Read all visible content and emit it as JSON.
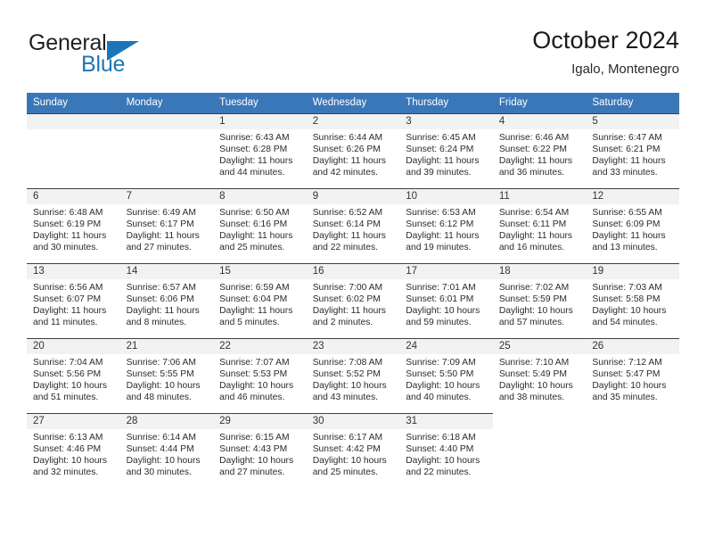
{
  "logo": {
    "word_one": "General",
    "word_two": "Blue",
    "triangle_icon": "triangle-icon",
    "brand_color": "#1b75bb"
  },
  "header": {
    "title": "October 2024",
    "subtitle": "Igalo, Montenegro"
  },
  "theme": {
    "header_bg": "#3a77b8",
    "header_text": "#ffffff",
    "day_band_bg": "#f2f2f2",
    "cell_border": "#3f3f3f",
    "text": "#2b2b2b"
  },
  "weekday_headers": [
    "Sunday",
    "Monday",
    "Tuesday",
    "Wednesday",
    "Thursday",
    "Friday",
    "Saturday"
  ],
  "weeks": [
    [
      {
        "empty": true
      },
      {
        "empty": true
      },
      {
        "day": "1",
        "sunrise": "Sunrise: 6:43 AM",
        "sunset": "Sunset: 6:28 PM",
        "daylight": "Daylight: 11 hours and 44 minutes."
      },
      {
        "day": "2",
        "sunrise": "Sunrise: 6:44 AM",
        "sunset": "Sunset: 6:26 PM",
        "daylight": "Daylight: 11 hours and 42 minutes."
      },
      {
        "day": "3",
        "sunrise": "Sunrise: 6:45 AM",
        "sunset": "Sunset: 6:24 PM",
        "daylight": "Daylight: 11 hours and 39 minutes."
      },
      {
        "day": "4",
        "sunrise": "Sunrise: 6:46 AM",
        "sunset": "Sunset: 6:22 PM",
        "daylight": "Daylight: 11 hours and 36 minutes."
      },
      {
        "day": "5",
        "sunrise": "Sunrise: 6:47 AM",
        "sunset": "Sunset: 6:21 PM",
        "daylight": "Daylight: 11 hours and 33 minutes."
      }
    ],
    [
      {
        "day": "6",
        "sunrise": "Sunrise: 6:48 AM",
        "sunset": "Sunset: 6:19 PM",
        "daylight": "Daylight: 11 hours and 30 minutes."
      },
      {
        "day": "7",
        "sunrise": "Sunrise: 6:49 AM",
        "sunset": "Sunset: 6:17 PM",
        "daylight": "Daylight: 11 hours and 27 minutes."
      },
      {
        "day": "8",
        "sunrise": "Sunrise: 6:50 AM",
        "sunset": "Sunset: 6:16 PM",
        "daylight": "Daylight: 11 hours and 25 minutes."
      },
      {
        "day": "9",
        "sunrise": "Sunrise: 6:52 AM",
        "sunset": "Sunset: 6:14 PM",
        "daylight": "Daylight: 11 hours and 22 minutes."
      },
      {
        "day": "10",
        "sunrise": "Sunrise: 6:53 AM",
        "sunset": "Sunset: 6:12 PM",
        "daylight": "Daylight: 11 hours and 19 minutes."
      },
      {
        "day": "11",
        "sunrise": "Sunrise: 6:54 AM",
        "sunset": "Sunset: 6:11 PM",
        "daylight": "Daylight: 11 hours and 16 minutes."
      },
      {
        "day": "12",
        "sunrise": "Sunrise: 6:55 AM",
        "sunset": "Sunset: 6:09 PM",
        "daylight": "Daylight: 11 hours and 13 minutes."
      }
    ],
    [
      {
        "day": "13",
        "sunrise": "Sunrise: 6:56 AM",
        "sunset": "Sunset: 6:07 PM",
        "daylight": "Daylight: 11 hours and 11 minutes."
      },
      {
        "day": "14",
        "sunrise": "Sunrise: 6:57 AM",
        "sunset": "Sunset: 6:06 PM",
        "daylight": "Daylight: 11 hours and 8 minutes."
      },
      {
        "day": "15",
        "sunrise": "Sunrise: 6:59 AM",
        "sunset": "Sunset: 6:04 PM",
        "daylight": "Daylight: 11 hours and 5 minutes."
      },
      {
        "day": "16",
        "sunrise": "Sunrise: 7:00 AM",
        "sunset": "Sunset: 6:02 PM",
        "daylight": "Daylight: 11 hours and 2 minutes."
      },
      {
        "day": "17",
        "sunrise": "Sunrise: 7:01 AM",
        "sunset": "Sunset: 6:01 PM",
        "daylight": "Daylight: 10 hours and 59 minutes."
      },
      {
        "day": "18",
        "sunrise": "Sunrise: 7:02 AM",
        "sunset": "Sunset: 5:59 PM",
        "daylight": "Daylight: 10 hours and 57 minutes."
      },
      {
        "day": "19",
        "sunrise": "Sunrise: 7:03 AM",
        "sunset": "Sunset: 5:58 PM",
        "daylight": "Daylight: 10 hours and 54 minutes."
      }
    ],
    [
      {
        "day": "20",
        "sunrise": "Sunrise: 7:04 AM",
        "sunset": "Sunset: 5:56 PM",
        "daylight": "Daylight: 10 hours and 51 minutes."
      },
      {
        "day": "21",
        "sunrise": "Sunrise: 7:06 AM",
        "sunset": "Sunset: 5:55 PM",
        "daylight": "Daylight: 10 hours and 48 minutes."
      },
      {
        "day": "22",
        "sunrise": "Sunrise: 7:07 AM",
        "sunset": "Sunset: 5:53 PM",
        "daylight": "Daylight: 10 hours and 46 minutes."
      },
      {
        "day": "23",
        "sunrise": "Sunrise: 7:08 AM",
        "sunset": "Sunset: 5:52 PM",
        "daylight": "Daylight: 10 hours and 43 minutes."
      },
      {
        "day": "24",
        "sunrise": "Sunrise: 7:09 AM",
        "sunset": "Sunset: 5:50 PM",
        "daylight": "Daylight: 10 hours and 40 minutes."
      },
      {
        "day": "25",
        "sunrise": "Sunrise: 7:10 AM",
        "sunset": "Sunset: 5:49 PM",
        "daylight": "Daylight: 10 hours and 38 minutes."
      },
      {
        "day": "26",
        "sunrise": "Sunrise: 7:12 AM",
        "sunset": "Sunset: 5:47 PM",
        "daylight": "Daylight: 10 hours and 35 minutes."
      }
    ],
    [
      {
        "day": "27",
        "sunrise": "Sunrise: 6:13 AM",
        "sunset": "Sunset: 4:46 PM",
        "daylight": "Daylight: 10 hours and 32 minutes."
      },
      {
        "day": "28",
        "sunrise": "Sunrise: 6:14 AM",
        "sunset": "Sunset: 4:44 PM",
        "daylight": "Daylight: 10 hours and 30 minutes."
      },
      {
        "day": "29",
        "sunrise": "Sunrise: 6:15 AM",
        "sunset": "Sunset: 4:43 PM",
        "daylight": "Daylight: 10 hours and 27 minutes."
      },
      {
        "day": "30",
        "sunrise": "Sunrise: 6:17 AM",
        "sunset": "Sunset: 4:42 PM",
        "daylight": "Daylight: 10 hours and 25 minutes."
      },
      {
        "day": "31",
        "sunrise": "Sunrise: 6:18 AM",
        "sunset": "Sunset: 4:40 PM",
        "daylight": "Daylight: 10 hours and 22 minutes."
      },
      {
        "empty": true,
        "no_band": true
      },
      {
        "empty": true,
        "no_band": true
      }
    ]
  ]
}
